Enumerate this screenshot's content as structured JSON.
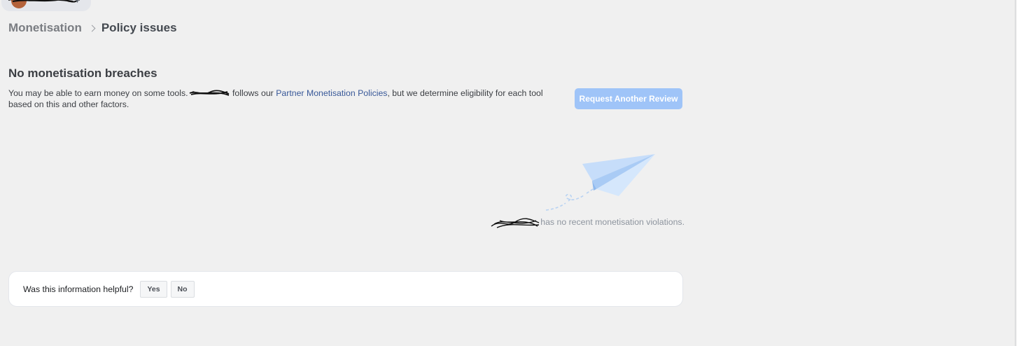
{
  "breadcrumb": {
    "parent": "Monetisation",
    "current": "Policy issues"
  },
  "section": {
    "title": "No monetisation breaches",
    "desc_part1": "You may be able to earn money on some tools.",
    "desc_part2": " follows our ",
    "policy_link": "Partner Monetisation Policies",
    "desc_part3": ", but we determine eligibility for each tool based on this and other factors."
  },
  "actions": {
    "request_review": "Request Another Review"
  },
  "empty_state": {
    "message": "has no recent monetisation violations.",
    "icon": "paper-plane-icon"
  },
  "feedback": {
    "question": "Was this information helpful?",
    "yes": "Yes",
    "no": "No"
  },
  "colors": {
    "link": "#385898",
    "button_disabled": "#9fc4f8",
    "background": "#f0f0f0"
  }
}
